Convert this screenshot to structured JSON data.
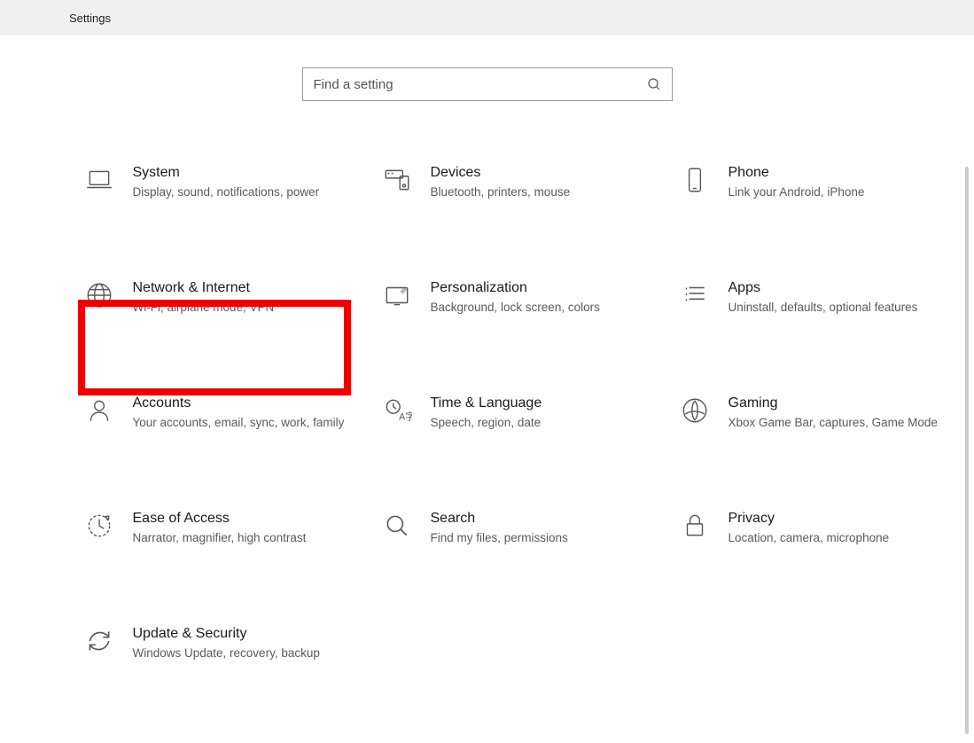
{
  "window": {
    "title": "Settings"
  },
  "search": {
    "placeholder": "Find a setting"
  },
  "categories": [
    {
      "id": "system",
      "title": "System",
      "desc": "Display, sound, notifications, power"
    },
    {
      "id": "devices",
      "title": "Devices",
      "desc": "Bluetooth, printers, mouse"
    },
    {
      "id": "phone",
      "title": "Phone",
      "desc": "Link your Android, iPhone"
    },
    {
      "id": "network",
      "title": "Network & Internet",
      "desc": "Wi-Fi, airplane mode, VPN"
    },
    {
      "id": "personalization",
      "title": "Personalization",
      "desc": "Background, lock screen, colors"
    },
    {
      "id": "apps",
      "title": "Apps",
      "desc": "Uninstall, defaults, optional features"
    },
    {
      "id": "accounts",
      "title": "Accounts",
      "desc": "Your accounts, email, sync, work, family"
    },
    {
      "id": "time",
      "title": "Time & Language",
      "desc": "Speech, region, date"
    },
    {
      "id": "gaming",
      "title": "Gaming",
      "desc": "Xbox Game Bar, captures, Game Mode"
    },
    {
      "id": "ease",
      "title": "Ease of Access",
      "desc": "Narrator, magnifier, high contrast"
    },
    {
      "id": "search",
      "title": "Search",
      "desc": "Find my files, permissions"
    },
    {
      "id": "privacy",
      "title": "Privacy",
      "desc": "Location, camera, microphone"
    },
    {
      "id": "update",
      "title": "Update & Security",
      "desc": "Windows Update, recovery, backup"
    }
  ],
  "highlighted_category_id": "network"
}
